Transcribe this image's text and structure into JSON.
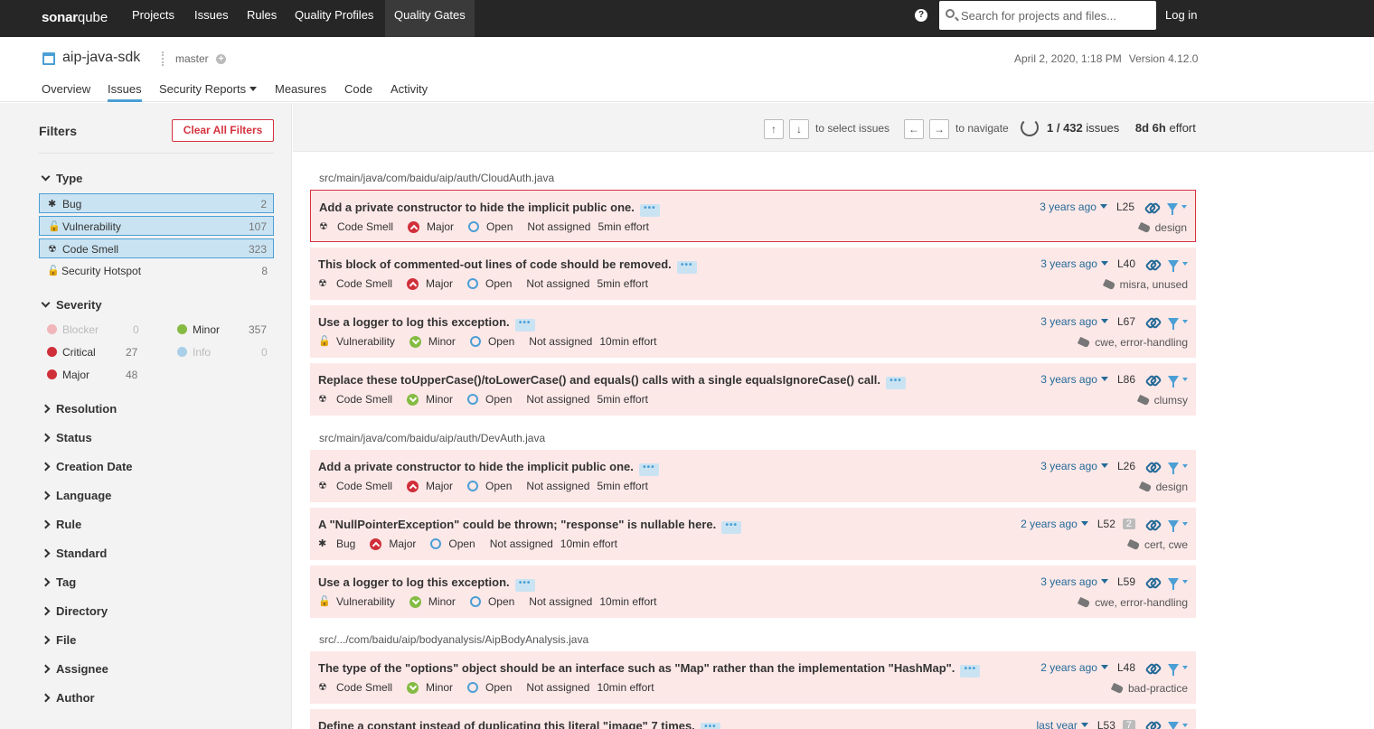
{
  "topnav": {
    "logo_a": "sonar",
    "logo_b": "qube",
    "items": [
      "Projects",
      "Issues",
      "Rules",
      "Quality Profiles",
      "Quality Gates"
    ],
    "active": "Quality Gates",
    "help": "?",
    "search_placeholder": "Search for projects and files...",
    "login": "Log in"
  },
  "project": {
    "name": "aip-java-sdk",
    "branch": "master",
    "date": "April 2, 2020, 1:18 PM",
    "version": "Version 4.12.0",
    "tabs": [
      "Overview",
      "Issues",
      "Security Reports",
      "Measures",
      "Code",
      "Activity"
    ],
    "active_tab": "Issues"
  },
  "sidebar": {
    "title": "Filters",
    "clear_all": "Clear All Filters",
    "type_heading": "Type",
    "types": [
      {
        "label": "Bug",
        "count": "2",
        "selected": true,
        "icon": "bug-icon"
      },
      {
        "label": "Vulnerability",
        "count": "107",
        "selected": true,
        "icon": "lock-icon"
      },
      {
        "label": "Code Smell",
        "count": "323",
        "selected": true,
        "icon": "code-smell-icon"
      },
      {
        "label": "Security Hotspot",
        "count": "8",
        "selected": false,
        "icon": "lock-icon"
      }
    ],
    "severity_heading": "Severity",
    "severities": [
      {
        "label": "Blocker",
        "count": "0",
        "color": "#d02f3a"
      },
      {
        "label": "Minor",
        "count": "357",
        "color": "#85bb43"
      },
      {
        "label": "Critical",
        "count": "27",
        "color": "#d02f3a"
      },
      {
        "label": "Info",
        "count": "0",
        "color": "#4b9fd5"
      },
      {
        "label": "Major",
        "count": "48",
        "color": "#d02f3a"
      }
    ],
    "collapsed": [
      "Resolution",
      "Status",
      "Creation Date",
      "Language",
      "Rule",
      "Standard",
      "Tag",
      "Directory",
      "File",
      "Assignee",
      "Author"
    ]
  },
  "toolbar": {
    "up": "↑",
    "down": "↓",
    "select_text": "to select issues",
    "left": "←",
    "right": "→",
    "nav_text": "to navigate",
    "count": "1 / 432",
    "count_suffix": "issues",
    "effort": "8d 6h",
    "effort_suffix": "effort"
  },
  "files": [
    "src/main/java/com/baidu/aip/auth/CloudAuth.java",
    "src/main/java/com/baidu/aip/auth/DevAuth.java",
    "src/.../com/baidu/aip/bodyanalysis/AipBodyAnalysis.java"
  ],
  "issues": [
    {
      "message": "Add a private constructor to hide the implicit public one.",
      "type": "Code Smell",
      "severity": "Major",
      "status": "Open",
      "assignee": "Not assigned",
      "effort": "5min effort",
      "age": "3 years ago",
      "line": "L25",
      "tags": "design"
    },
    {
      "message": "This block of commented-out lines of code should be removed.",
      "type": "Code Smell",
      "severity": "Major",
      "status": "Open",
      "assignee": "Not assigned",
      "effort": "5min effort",
      "age": "3 years ago",
      "line": "L40",
      "tags": "misra, unused"
    },
    {
      "message": "Use a logger to log this exception.",
      "type": "Vulnerability",
      "severity": "Minor",
      "status": "Open",
      "assignee": "Not assigned",
      "effort": "10min effort",
      "age": "3 years ago",
      "line": "L67",
      "tags": "cwe, error-handling"
    },
    {
      "message": "Replace these toUpperCase()/toLowerCase() and equals() calls with a single equalsIgnoreCase() call.",
      "type": "Code Smell",
      "severity": "Minor",
      "status": "Open",
      "assignee": "Not assigned",
      "effort": "5min effort",
      "age": "3 years ago",
      "line": "L86",
      "tags": "clumsy"
    },
    {
      "message": "Add a private constructor to hide the implicit public one.",
      "type": "Code Smell",
      "severity": "Major",
      "status": "Open",
      "assignee": "Not assigned",
      "effort": "5min effort",
      "age": "3 years ago",
      "line": "L26",
      "tags": "design"
    },
    {
      "message": "A \"NullPointerException\" could be thrown; \"response\" is nullable here.",
      "type": "Bug",
      "severity": "Major",
      "status": "Open",
      "assignee": "Not assigned",
      "effort": "10min effort",
      "age": "2 years ago",
      "line": "L52",
      "badge": "2",
      "tags": "cert, cwe"
    },
    {
      "message": "Use a logger to log this exception.",
      "type": "Vulnerability",
      "severity": "Minor",
      "status": "Open",
      "assignee": "Not assigned",
      "effort": "10min effort",
      "age": "3 years ago",
      "line": "L59",
      "tags": "cwe, error-handling"
    },
    {
      "message": "The type of the \"options\" object should be an interface such as \"Map\" rather than the implementation \"HashMap\".",
      "type": "Code Smell",
      "severity": "Minor",
      "status": "Open",
      "assignee": "Not assigned",
      "effort": "10min effort",
      "age": "2 years ago",
      "line": "L48",
      "tags": "bad-practice"
    },
    {
      "message": "Define a constant instead of duplicating this literal \"image\" 7 times.",
      "age": "last year",
      "line": "L53",
      "badge": "7"
    }
  ],
  "colors": {
    "accent": "#4b9fd5",
    "error": "#d4333f",
    "issue_bg": "#fde8e8",
    "topbar": "#262626"
  }
}
